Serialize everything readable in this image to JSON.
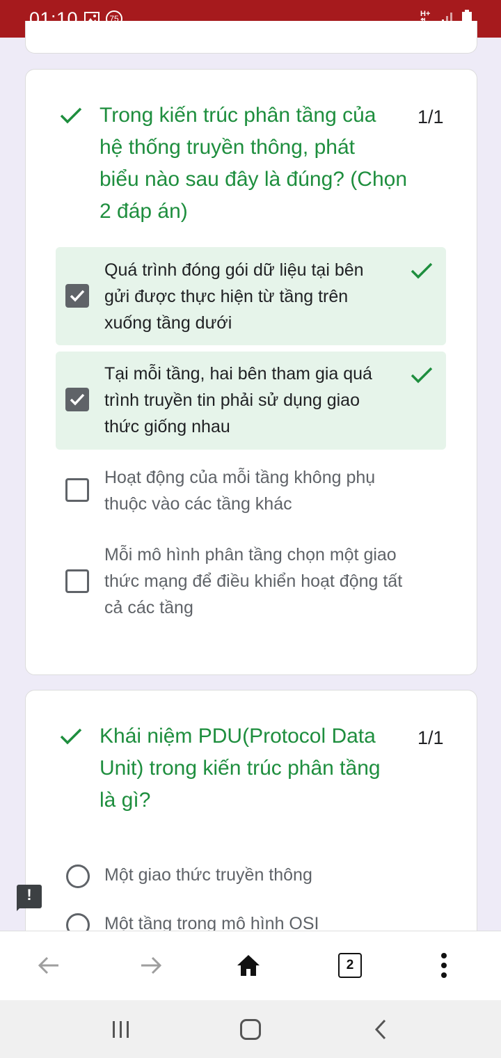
{
  "status_bar": {
    "time": "01:10",
    "notification_count": "75",
    "network_type": "H+"
  },
  "questions": [
    {
      "title": "Trong kiến trúc phân tầng của hệ thống truyền thông, phát biểu nào sau đây là đúng? (Chọn 2 đáp án)",
      "title_lines": [
        "Trong kiến trúc phân tầng của",
        "hệ thống truyền thông, phát",
        "biểu nào sau đây là đúng? (Chọn",
        "2 đáp án)"
      ],
      "score": "1/1",
      "options": [
        {
          "lines": [
            "Quá trình đóng gói dữ liệu tại bên",
            "gửi được thực hiện từ tầng trên",
            "xuống tầng dưới"
          ],
          "checked": true,
          "correct": true
        },
        {
          "lines": [
            "Tại mỗi tầng, hai bên tham gia quá",
            "trình truyền tin phải sử dụng giao",
            "thức giống nhau"
          ],
          "checked": true,
          "correct": true
        },
        {
          "lines": [
            "Hoạt động của mỗi tầng không phụ",
            "thuộc vào các tầng khác"
          ],
          "checked": false,
          "correct": false
        },
        {
          "lines": [
            "Mỗi mô hình phân tầng chọn một giao",
            "thức mạng để điều khiển hoạt động tất",
            "cả các tầng"
          ],
          "checked": false,
          "correct": false
        }
      ]
    },
    {
      "title": "Khái niệm PDU(Protocol Data Unit) trong kiến trúc phân tầng là gì?",
      "title_lines": [
        "Khái niệm PDU(Protocol Data",
        "Unit) trong kiến trúc phân tầng",
        "là gì?"
      ],
      "score": "1/1",
      "options": [
        {
          "text": "Một giao thức truyền thông"
        },
        {
          "text": "Một tầng trong mô hình OSI"
        }
      ]
    }
  ],
  "browser_nav": {
    "tab_count": "2"
  },
  "colors": {
    "status_bar": "#A61A1D",
    "correct_green": "#1E8E3E",
    "correct_bg": "#E6F4EA",
    "page_bg": "#EEEBF7"
  }
}
